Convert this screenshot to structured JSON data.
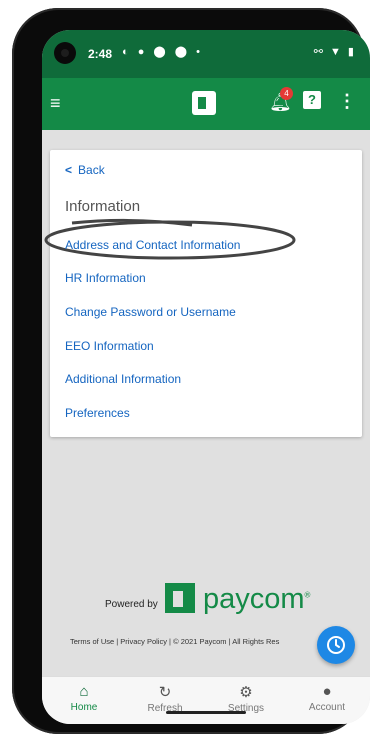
{
  "status_bar": {
    "time": "2:48",
    "left_icons": "◐ ● ⬤ ⬤ •",
    "right_icons": "⚯ ▼ ▮"
  },
  "app_bar": {
    "notification_count": "4",
    "menu_icon": "hamburger-icon",
    "help_icon": "help-icon",
    "more_icon": "more-vert-icon"
  },
  "card": {
    "back_label": "Back",
    "heading": "Information",
    "links": [
      "Address and Contact Information",
      "HR Information",
      "Change Password or Username",
      "EEO Information",
      "Additional Information",
      "Preferences"
    ]
  },
  "footer": {
    "powered_by": "Powered by",
    "brand": "paycom",
    "trademark": "®",
    "terms": "Terms of Use | Privacy Policy | © 2021 Paycom | All Rights Res"
  },
  "bottom_nav": [
    {
      "label": "Home",
      "icon": "home-icon",
      "active": true
    },
    {
      "label": "Refresh",
      "icon": "refresh-icon",
      "active": false
    },
    {
      "label": "Settings",
      "icon": "gear-icon",
      "active": false
    },
    {
      "label": "Account",
      "icon": "account-icon",
      "active": false
    }
  ],
  "colors": {
    "brand_green": "#148a47",
    "status_green": "#0f6b3a",
    "link_blue": "#1565c0",
    "fab_blue": "#1e88e5",
    "badge_red": "#e53935"
  }
}
